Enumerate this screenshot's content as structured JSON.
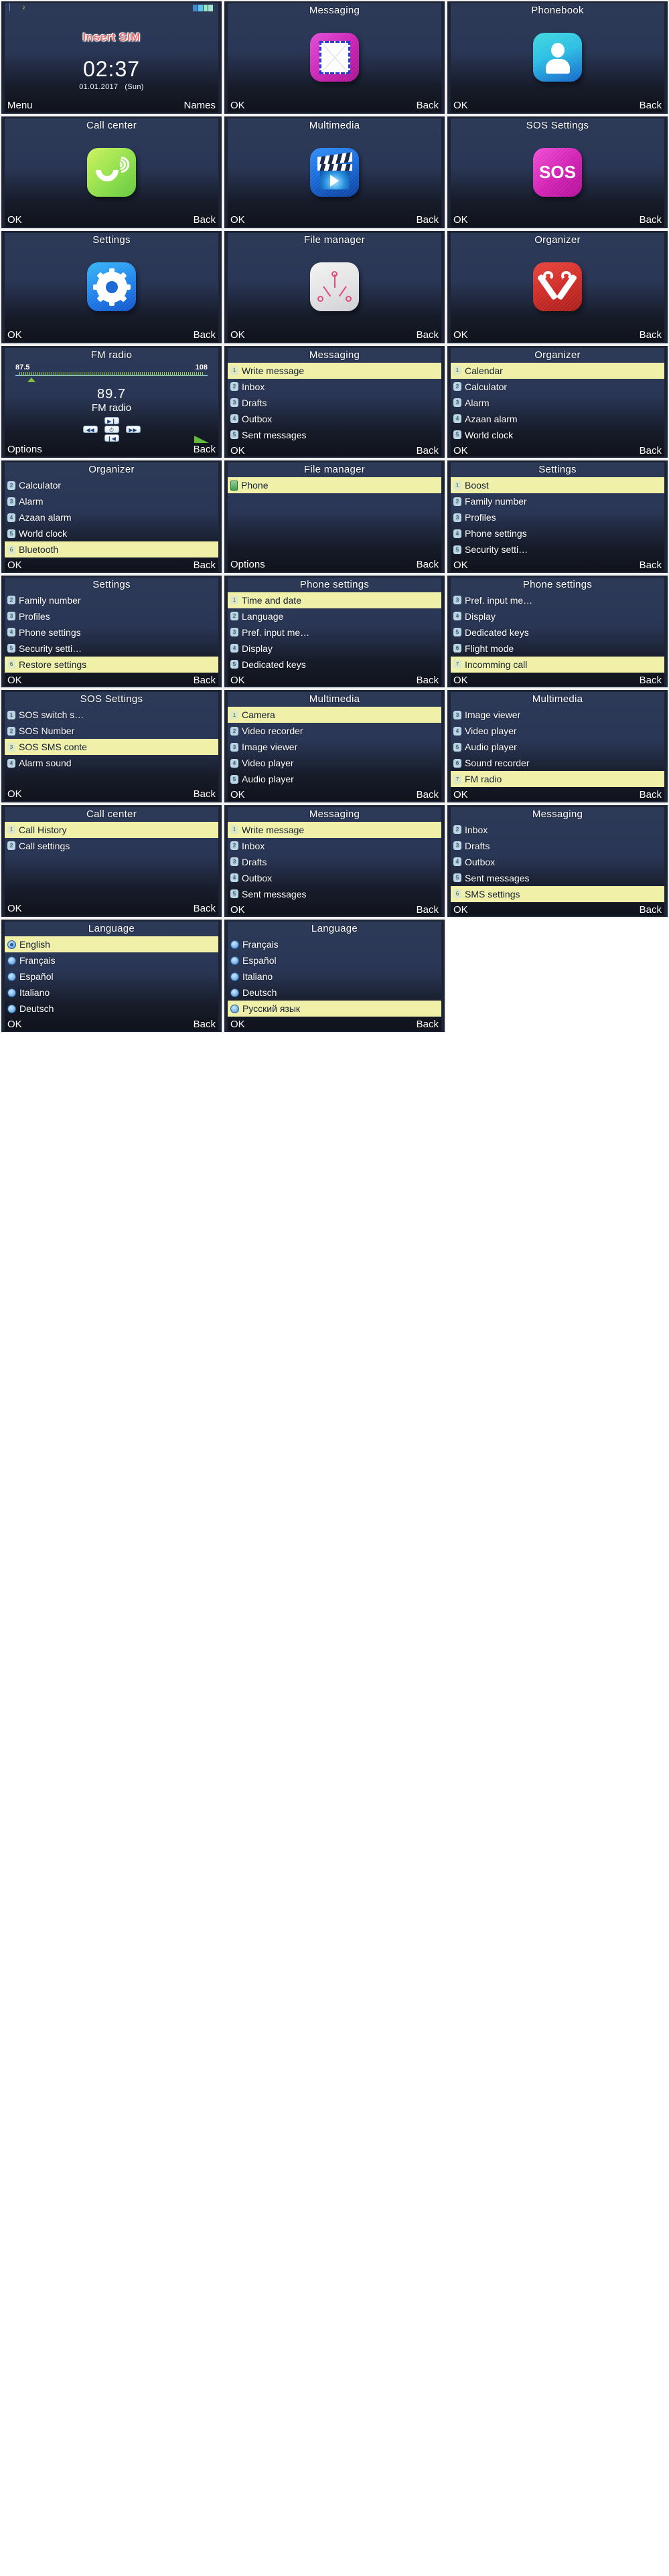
{
  "device": "feature-phone-ui-contact-sheet",
  "home": {
    "status": {
      "sim_icon": "sim-icon",
      "note_icon": "music-note-icon",
      "battery": "battery-icon"
    },
    "insert_sim": "Insert SIM",
    "time": "02:37",
    "date": "01.01.2017",
    "weekday": "(Sun)",
    "left_softkey": "Menu",
    "right_softkey": "Names"
  },
  "softkeys": {
    "ok": "OK",
    "back": "Back",
    "options": "Options"
  },
  "fm": {
    "title": "FM radio",
    "range_min": "87.5",
    "range_max": "108",
    "frequency": "89.7",
    "label": "FM radio",
    "buttons": [
      "play-pause",
      "rewind",
      "power",
      "fast-forward",
      "prev-track"
    ],
    "left_softkey": "Options",
    "right_softkey": "Back"
  },
  "icon_screens": [
    {
      "title": "Messaging",
      "icon": "envelope-icon",
      "left": "OK",
      "right": "Back"
    },
    {
      "title": "Phonebook",
      "icon": "person-icon",
      "left": "OK",
      "right": "Back"
    },
    {
      "title": "Call center",
      "icon": "handset-icon",
      "left": "OK",
      "right": "Back"
    },
    {
      "title": "Multimedia",
      "icon": "clapperboard-icon",
      "left": "OK",
      "right": "Back"
    },
    {
      "title": "SOS Settings",
      "icon": "sos-icon",
      "left": "OK",
      "right": "Back"
    },
    {
      "title": "Settings",
      "icon": "gear-icon",
      "left": "OK",
      "right": "Back"
    },
    {
      "title": "File manager",
      "icon": "file-tree-icon",
      "left": "OK",
      "right": "Back"
    },
    {
      "title": "Organizer",
      "icon": "tools-icon",
      "left": "OK",
      "right": "Back"
    }
  ],
  "list_screens": [
    {
      "title": "Messaging",
      "items": [
        {
          "num": "1",
          "label": "Write message",
          "selected": true
        },
        {
          "num": "2",
          "label": "Inbox",
          "selected": false
        },
        {
          "num": "3",
          "label": "Drafts",
          "selected": false
        },
        {
          "num": "4",
          "label": "Outbox",
          "selected": false
        },
        {
          "num": "5",
          "label": "Sent messages",
          "selected": false
        }
      ],
      "left": "OK",
      "right": "Back"
    },
    {
      "title": "Organizer",
      "items": [
        {
          "num": "1",
          "label": "Calendar",
          "selected": true
        },
        {
          "num": "2",
          "label": "Calculator",
          "selected": false
        },
        {
          "num": "3",
          "label": "Alarm",
          "selected": false
        },
        {
          "num": "4",
          "label": "Azaan alarm",
          "selected": false
        },
        {
          "num": "5",
          "label": "World clock",
          "selected": false
        }
      ],
      "left": "OK",
      "right": "Back"
    },
    {
      "title": "Organizer",
      "items": [
        {
          "num": "2",
          "label": "Calculator",
          "selected": false
        },
        {
          "num": "3",
          "label": "Alarm",
          "selected": false
        },
        {
          "num": "4",
          "label": "Azaan alarm",
          "selected": false
        },
        {
          "num": "5",
          "label": "World clock",
          "selected": false
        },
        {
          "num": "6",
          "label": "Bluetooth",
          "selected": true
        }
      ],
      "left": "OK",
      "right": "Back"
    },
    {
      "title": "File manager",
      "items": [
        {
          "num": "phone",
          "label": "Phone",
          "selected": true,
          "icon": "phone-storage-icon"
        }
      ],
      "left": "Options",
      "right": "Back"
    },
    {
      "title": "Settings",
      "items": [
        {
          "num": "1",
          "label": "Boost",
          "selected": true
        },
        {
          "num": "2",
          "label": "Family number",
          "selected": false
        },
        {
          "num": "3",
          "label": "Profiles",
          "selected": false
        },
        {
          "num": "4",
          "label": "Phone settings",
          "selected": false
        },
        {
          "num": "5",
          "label": "Security setti…",
          "selected": false
        }
      ],
      "left": "OK",
      "right": "Back"
    },
    {
      "title": "Settings",
      "items": [
        {
          "num": "2",
          "label": "Family number",
          "selected": false
        },
        {
          "num": "3",
          "label": "Profiles",
          "selected": false
        },
        {
          "num": "4",
          "label": "Phone settings",
          "selected": false
        },
        {
          "num": "5",
          "label": "Security setti…",
          "selected": false
        },
        {
          "num": "6",
          "label": "Restore settings",
          "selected": true
        }
      ],
      "left": "OK",
      "right": "Back"
    },
    {
      "title": "Phone settings",
      "items": [
        {
          "num": "1",
          "label": "Time and date",
          "selected": true
        },
        {
          "num": "2",
          "label": "Language",
          "selected": false
        },
        {
          "num": "3",
          "label": "Pref. input me…",
          "selected": false
        },
        {
          "num": "4",
          "label": "Display",
          "selected": false
        },
        {
          "num": "5",
          "label": "Dedicated keys",
          "selected": false
        }
      ],
      "left": "OK",
      "right": "Back"
    },
    {
      "title": "Phone settings",
      "items": [
        {
          "num": "3",
          "label": "Pref. input me…",
          "selected": false
        },
        {
          "num": "4",
          "label": "Display",
          "selected": false
        },
        {
          "num": "5",
          "label": "Dedicated keys",
          "selected": false
        },
        {
          "num": "6",
          "label": "Flight mode",
          "selected": false
        },
        {
          "num": "7",
          "label": "Incomming call",
          "selected": true
        }
      ],
      "left": "OK",
      "right": "Back"
    },
    {
      "title": "SOS Settings",
      "items": [
        {
          "num": "1",
          "label": "SOS switch s…",
          "selected": false
        },
        {
          "num": "2",
          "label": "SOS Number",
          "selected": false
        },
        {
          "num": "3",
          "label": "SOS SMS conte",
          "selected": true
        },
        {
          "num": "4",
          "label": "Alarm sound",
          "selected": false
        }
      ],
      "left": "OK",
      "right": "Back"
    },
    {
      "title": "Multimedia",
      "items": [
        {
          "num": "1",
          "label": "Camera",
          "selected": true
        },
        {
          "num": "2",
          "label": "Video recorder",
          "selected": false
        },
        {
          "num": "3",
          "label": "Image viewer",
          "selected": false
        },
        {
          "num": "4",
          "label": "Video player",
          "selected": false
        },
        {
          "num": "5",
          "label": "Audio player",
          "selected": false
        }
      ],
      "left": "OK",
      "right": "Back"
    },
    {
      "title": "Multimedia",
      "items": [
        {
          "num": "3",
          "label": "Image viewer",
          "selected": false
        },
        {
          "num": "4",
          "label": "Video player",
          "selected": false
        },
        {
          "num": "5",
          "label": "Audio player",
          "selected": false
        },
        {
          "num": "6",
          "label": "Sound recorder",
          "selected": false
        },
        {
          "num": "7",
          "label": "FM radio",
          "selected": true
        }
      ],
      "left": "OK",
      "right": "Back"
    },
    {
      "title": "Call center",
      "items": [
        {
          "num": "1",
          "label": "Call History",
          "selected": true
        },
        {
          "num": "2",
          "label": "Call settings",
          "selected": false
        }
      ],
      "left": "OK",
      "right": "Back"
    },
    {
      "title": "Messaging",
      "items": [
        {
          "num": "1",
          "label": "Write message",
          "selected": true
        },
        {
          "num": "2",
          "label": "Inbox",
          "selected": false
        },
        {
          "num": "3",
          "label": "Drafts",
          "selected": false
        },
        {
          "num": "4",
          "label": "Outbox",
          "selected": false
        },
        {
          "num": "5",
          "label": "Sent messages",
          "selected": false
        }
      ],
      "left": "OK",
      "right": "Back"
    },
    {
      "title": "Messaging",
      "items": [
        {
          "num": "2",
          "label": "Inbox",
          "selected": false
        },
        {
          "num": "3",
          "label": "Drafts",
          "selected": false
        },
        {
          "num": "4",
          "label": "Outbox",
          "selected": false
        },
        {
          "num": "5",
          "label": "Sent messages",
          "selected": false
        },
        {
          "num": "6",
          "label": "SMS settings",
          "selected": true
        }
      ],
      "left": "OK",
      "right": "Back"
    }
  ],
  "language_screens": [
    {
      "title": "Language",
      "items": [
        {
          "label": "English",
          "selected": true,
          "checked": true
        },
        {
          "label": "Français",
          "selected": false,
          "checked": false
        },
        {
          "label": "Español",
          "selected": false,
          "checked": false
        },
        {
          "label": "Italiano",
          "selected": false,
          "checked": false
        },
        {
          "label": "Deutsch",
          "selected": false,
          "checked": false
        }
      ],
      "left": "OK",
      "right": "Back"
    },
    {
      "title": "Language",
      "items": [
        {
          "label": "Français",
          "selected": false,
          "checked": false
        },
        {
          "label": "Español",
          "selected": false,
          "checked": false
        },
        {
          "label": "Italiano",
          "selected": false,
          "checked": false
        },
        {
          "label": "Deutsch",
          "selected": false,
          "checked": false
        },
        {
          "label": "Русский язык",
          "selected": true,
          "checked": false
        }
      ],
      "left": "OK",
      "right": "Back"
    }
  ],
  "colors": {
    "screen_bg": "#2a3655",
    "highlight": "#f0f0a8",
    "text": "#ffffff",
    "accent_red": "#e2706e"
  }
}
